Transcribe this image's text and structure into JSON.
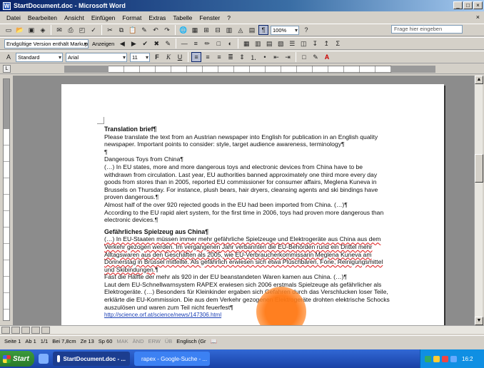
{
  "window": {
    "title": "StartDocument.doc - Microsoft Word",
    "buttons": [
      "_",
      "□",
      "×"
    ]
  },
  "menu": {
    "items": [
      "Datei",
      "Bearbeiten",
      "Ansicht",
      "Einfügen",
      "Format",
      "Extras",
      "Tabelle",
      "Fenster",
      "?"
    ],
    "help_placeholder": "Frage hier eingeben",
    "close": "×"
  },
  "toolbar_standard": {
    "zoom": "100%"
  },
  "toolbar_review": {
    "markup_mode": "Endgültige Version enthält Markups",
    "show_label": "Anzeigen"
  },
  "toolbar_format": {
    "style": "Standard",
    "font": "Arial",
    "size": "11",
    "bold": "F",
    "italic": "K",
    "underline": "U"
  },
  "document": {
    "brief_heading": "Translation brief",
    "brief_text": "Please translate the text from an Austrian newspaper into English for publication in an English quality newspaper. Important points to consider: style, target audience awareness, terminology",
    "pilcrow": "¶",
    "en_title": "Dangerous Toys from China",
    "en_para1": "(…) In EU states, more and more dangerous toys and electronic devices from China have to be withdrawn from circulation. Last year, EU authorities banned approximately one third more every day goods from stores than in 2005, reported EU commissioner for consumer affairs, Meglena Kuneva in Brussels on Thursday. For instance, plush bears, hair dryers, cleansing agents and ski bindings have proven dangerous.",
    "en_para2": "Almost half of the over 920 rejected goods in the EU had been imported from China. (…)",
    "en_para3": "According to the EU rapid alert system, for the first time in 2006, toys had proven more dangerous than electronic devices.",
    "de_title": "Gefährliches Spielzeug aus China",
    "de_para1": "(…) In EU-Staaten müssen immer mehr gefährliche Spielzeuge und Elektrogeräte aus China aus dem Verkehr gezogen werden. Im vergangenen Jahr verbannten die EU-Behörden rund ein Drittel mehr Alltagswaren aus den Geschäften als 2005, wie EU-Verbraucherkommissarin Meglena Kuneva am Donnerstag in Brüssel mitteilte. Als gefährlich erwiesen sich etwa Plüschbären, Föne, Reinigungsmittel und Skibindungen.",
    "de_para2": "Fast die Hälfte der mehr als 920 in der EU beanstandeten Waren kamen aus China. (…)",
    "de_para3": "Laut dem EU-Schnellwarnsystem RAPEX erwiesen sich 2006 erstmals Spielzeuge als gefährlicher als Elektrogeräte. (…) Besonders für Kleinkinder ergaben sich Gefahren durch das Verschlucken loser Teile, erklärte die EU-Kommission. Die aus dem Verkehr gezogenen Elektrogeräte drohten elektrische Schocks auszulösen und waren zum Teil nicht feuerfest",
    "source_link": "http://science.orf.at/science/news/147306.html"
  },
  "statusbar": {
    "page": "Seite 1",
    "section": "Ab 1",
    "pages": "1/1",
    "position": "Bei 7,8cm",
    "line": "Ze 13",
    "column": "Sp 60",
    "mak": "MAK",
    "aend": "ÄND",
    "erw": "ERW",
    "ub": "ÜB",
    "language": "Englisch (Gr"
  },
  "taskbar": {
    "start": "Start",
    "tasks": [
      "StartDocument.doc - ...",
      "rapex - Google-Suche - ..."
    ],
    "clock": "16:2"
  }
}
